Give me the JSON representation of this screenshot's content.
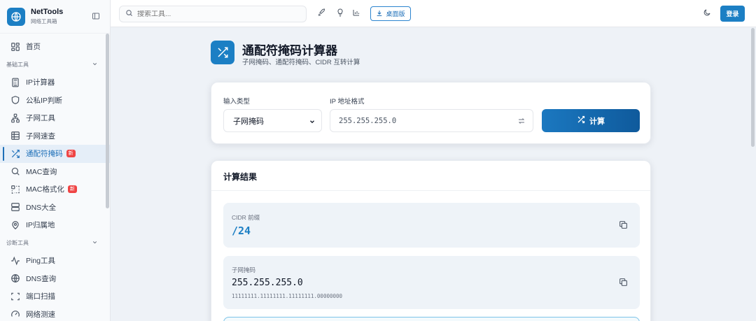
{
  "brand": {
    "name": "NetTools",
    "subtitle": "网络工具箱"
  },
  "sidebar": {
    "items_top": [
      {
        "label": "首页",
        "icon": "grid-icon"
      }
    ],
    "sections": [
      {
        "title": "基础工具",
        "items": [
          {
            "label": "IP计算器",
            "icon": "calculator-icon"
          },
          {
            "label": "公私IP判断",
            "icon": "shield-icon"
          },
          {
            "label": "子网工具",
            "icon": "network-icon"
          },
          {
            "label": "子网速查",
            "icon": "table-icon"
          },
          {
            "label": "通配符掩码",
            "icon": "shuffle-icon",
            "badge": "新",
            "active": true
          },
          {
            "label": "MAC查询",
            "icon": "search-icon"
          },
          {
            "label": "MAC格式化",
            "icon": "format-icon",
            "badge": "新"
          },
          {
            "label": "DNS大全",
            "icon": "server-icon"
          },
          {
            "label": "IP归属地",
            "icon": "map-pin-icon"
          }
        ]
      },
      {
        "title": "诊断工具",
        "items": [
          {
            "label": "Ping工具",
            "icon": "pulse-icon"
          },
          {
            "label": "DNS查询",
            "icon": "globe-icon"
          },
          {
            "label": "端口扫描",
            "icon": "scan-icon"
          },
          {
            "label": "网络测速",
            "icon": "gauge-icon"
          }
        ]
      }
    ]
  },
  "topbar": {
    "search_placeholder": "搜索工具...",
    "desktop_label": "桌面版",
    "login_label": "登录"
  },
  "page": {
    "title": "通配符掩码计算器",
    "subtitle": "子网掩码、通配符掩码、CIDR 互转计算"
  },
  "form": {
    "input_type_label": "输入类型",
    "input_type_value": "子网掩码",
    "ip_format_label": "IP 地址格式",
    "ip_value": "255.255.255.0",
    "calc_label": "计算"
  },
  "results": {
    "title": "计算结果",
    "cidr_label": "CIDR 前缀",
    "cidr_value": "/24",
    "mask_label": "子网掩码",
    "mask_value": "255.255.255.0",
    "mask_binary": "11111111.11111111.11111111.00000000"
  },
  "colors": {
    "accent": "#1c7fc4",
    "badge": "#ef4444",
    "cidr": "#1c7fc4"
  }
}
